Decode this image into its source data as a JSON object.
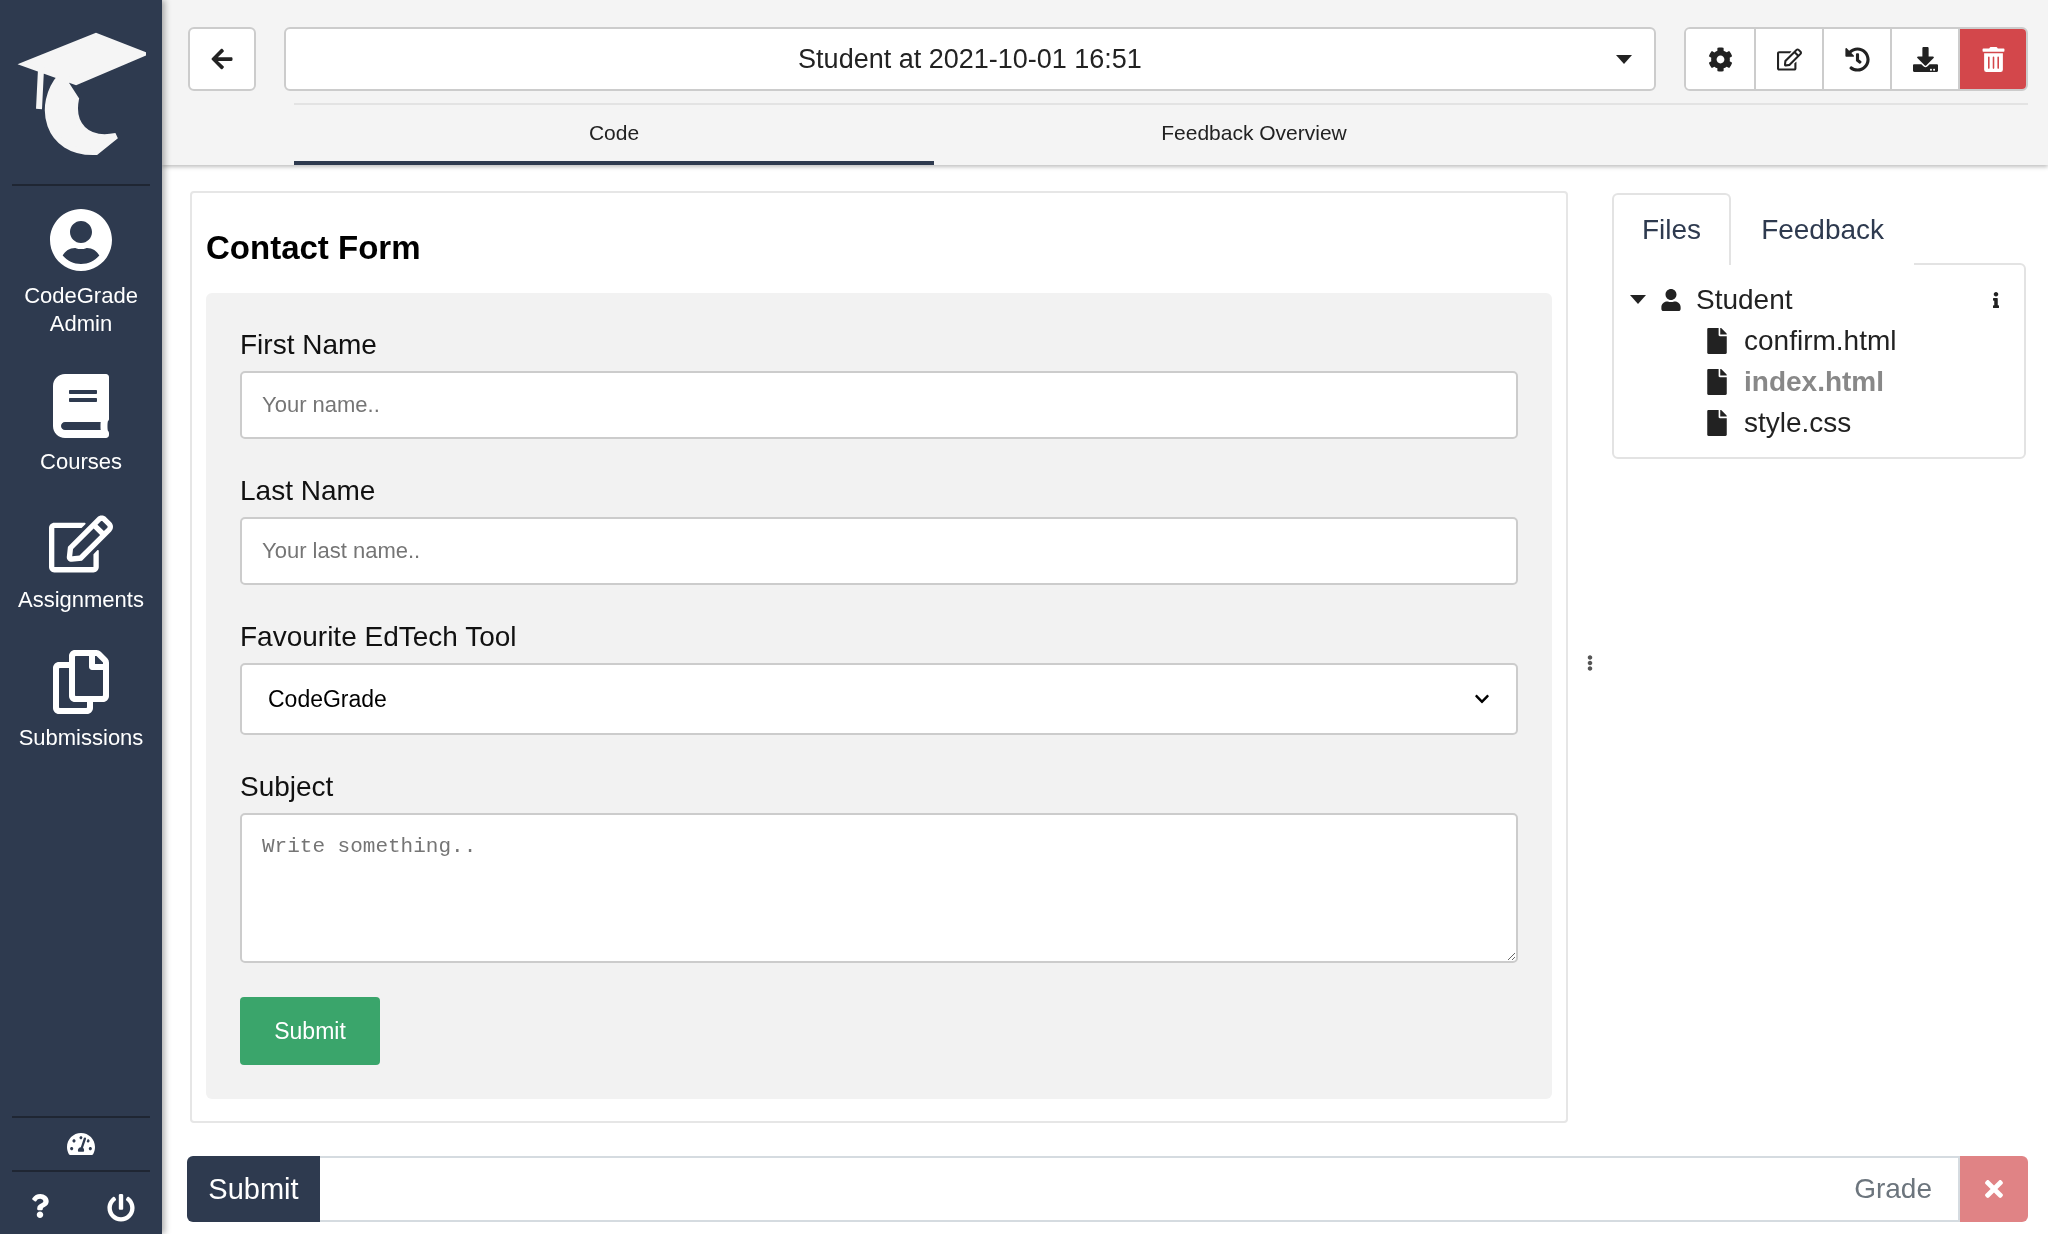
{
  "sidebar": {
    "items": [
      {
        "label": "CodeGrade\nAdmin"
      },
      {
        "label": "Courses"
      },
      {
        "label": "Assignments"
      },
      {
        "label": "Submissions"
      }
    ]
  },
  "header": {
    "title": "Student at 2021-10-01 16:51"
  },
  "tabs": [
    {
      "label": "Code",
      "selected": true
    },
    {
      "label": "Feedback Overview",
      "selected": false
    }
  ],
  "preview": {
    "title": "Contact Form",
    "fields": [
      {
        "kind": "input",
        "label": "First Name",
        "placeholder": "Your name.."
      },
      {
        "kind": "input",
        "label": "Last Name",
        "placeholder": "Your last name.."
      },
      {
        "kind": "select",
        "label": "Favourite EdTech Tool",
        "value": "CodeGrade"
      },
      {
        "kind": "textarea",
        "label": "Subject",
        "placeholder": "Write something.."
      }
    ],
    "submit": "Submit"
  },
  "side_tabs": [
    {
      "label": "Files",
      "selected": true
    },
    {
      "label": "Feedback",
      "selected": false
    }
  ],
  "file_tree": {
    "name": "Student",
    "expanded": true,
    "children": [
      {
        "name": "confirm.html",
        "selected": false
      },
      {
        "name": "index.html",
        "selected": true
      },
      {
        "name": "style.css",
        "selected": false
      }
    ]
  },
  "footer": {
    "submit": "Submit",
    "grade_placeholder": "Grade"
  }
}
